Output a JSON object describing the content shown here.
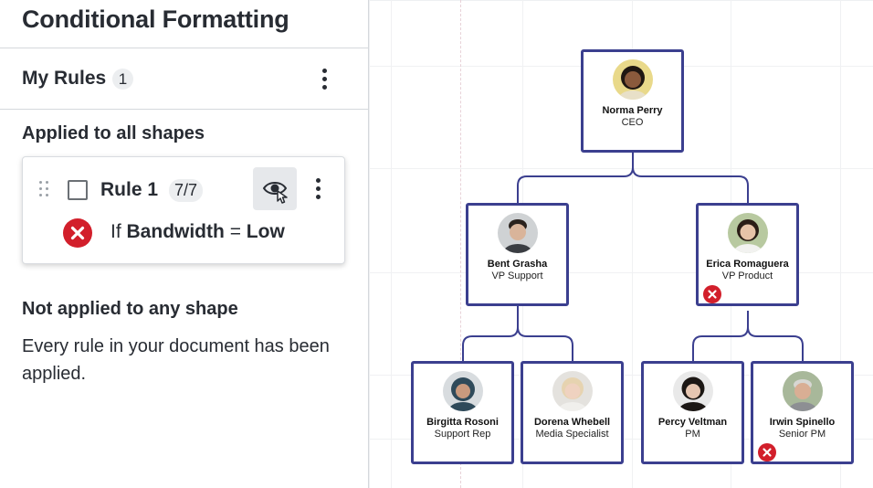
{
  "panel": {
    "title": "Conditional Formatting",
    "my_rules_label": "My Rules",
    "my_rules_count": "1",
    "applied_heading": "Applied to all shapes",
    "rule": {
      "name": "Rule 1",
      "count": "7/7",
      "condition_prefix": "If",
      "condition_field": "Bandwidth",
      "condition_op": "=",
      "condition_value": "Low",
      "status_icon": "error-x-icon",
      "visibility_icon": "eye-hand-icon"
    },
    "not_applied_heading": "Not applied to any shape",
    "not_applied_message": "Every rule in your document has been applied."
  },
  "org_chart": {
    "colors": {
      "card_border": "#3b3f8f",
      "error": "#d21f2b",
      "connector": "#3b3f8f"
    },
    "people": [
      {
        "name": "Norma Perry",
        "title": "CEO",
        "flagged": false
      },
      {
        "name": "Bent Grasha",
        "title": "VP Support",
        "flagged": false
      },
      {
        "name": "Erica Romaguera",
        "title": "VP Product",
        "flagged": true
      },
      {
        "name": "Birgitta Rosoni",
        "title": "Support Rep",
        "flagged": false
      },
      {
        "name": "Dorena Whebell",
        "title": "Media Specialist",
        "flagged": false
      },
      {
        "name": "Percy Veltman",
        "title": "PM",
        "flagged": false
      },
      {
        "name": "Irwin Spinello",
        "title": "Senior PM",
        "flagged": true
      }
    ]
  }
}
